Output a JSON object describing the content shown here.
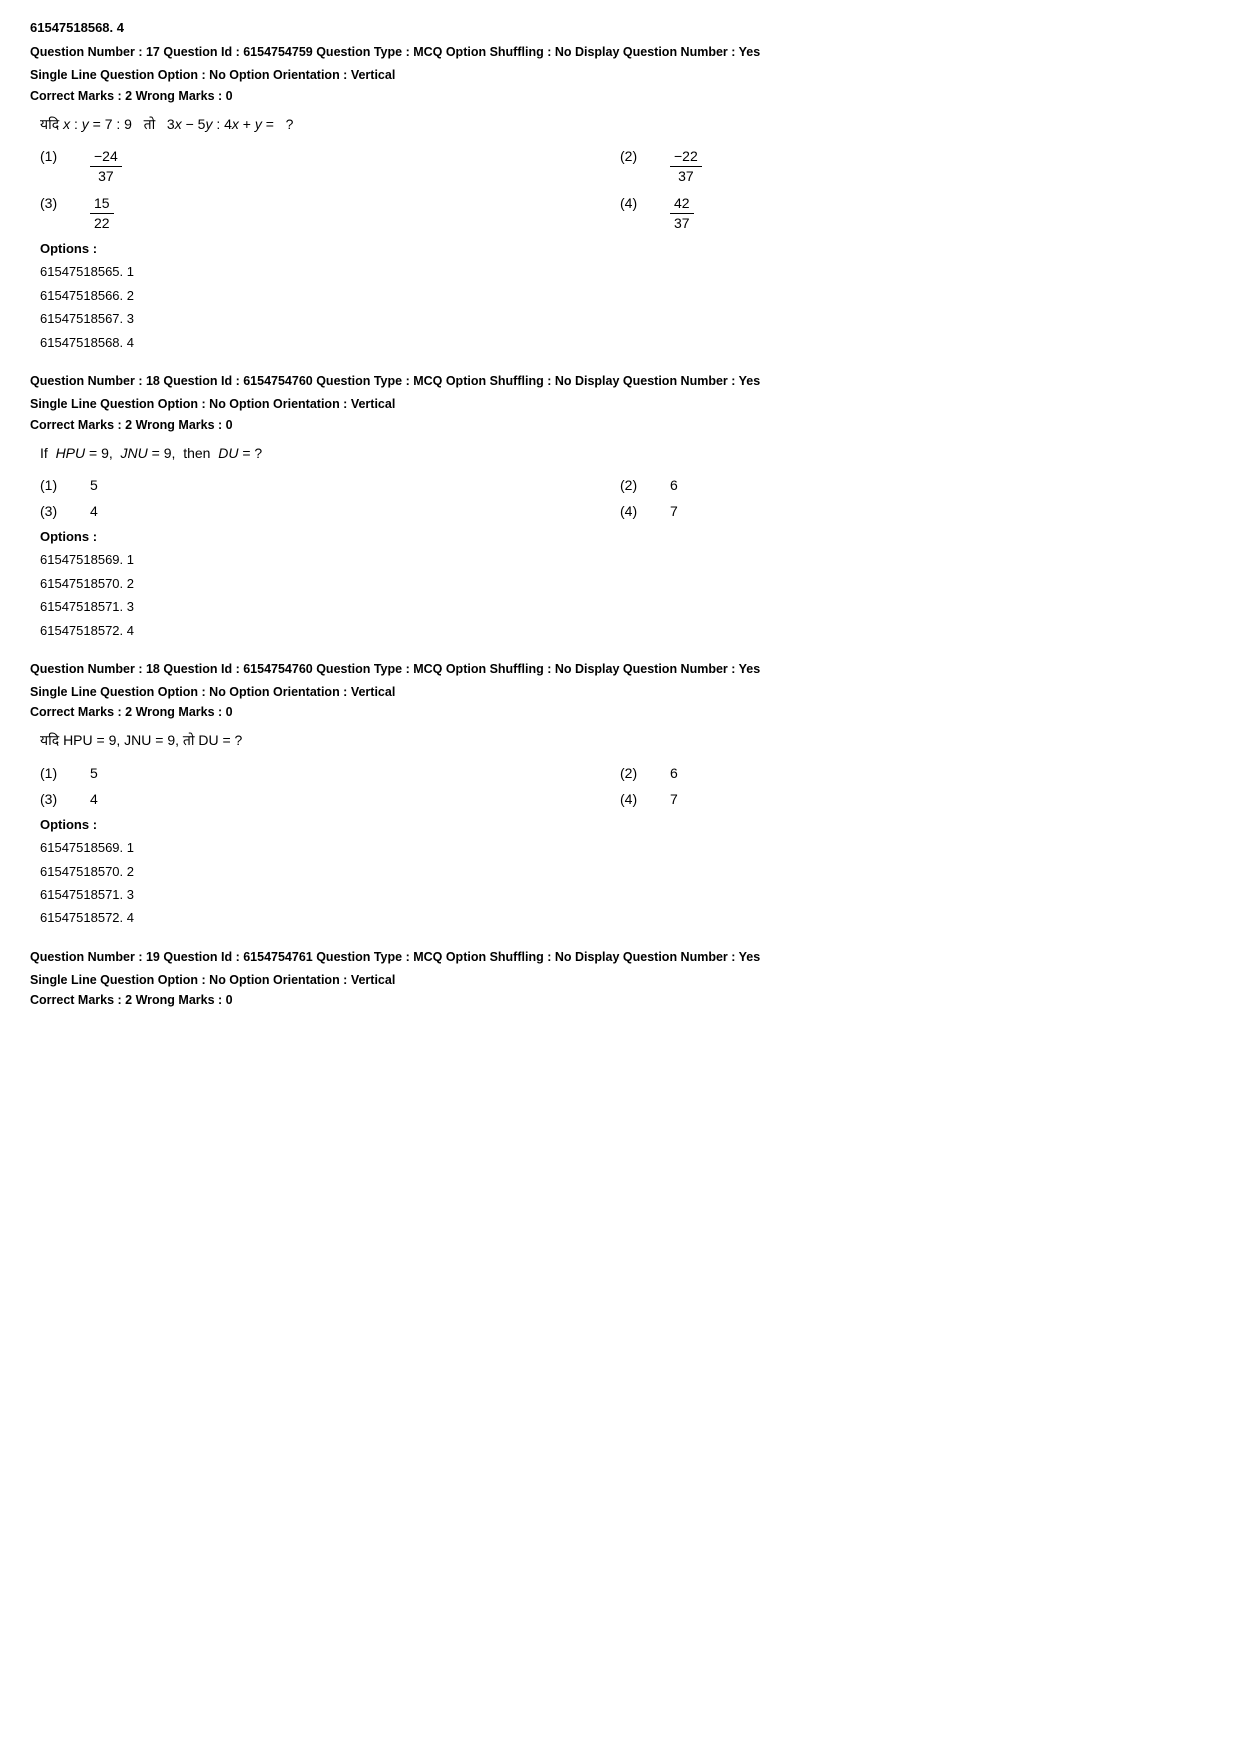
{
  "topId": "61547518568. 4",
  "questions": [
    {
      "id": "q17",
      "meta1": "Question Number : 17  Question Id : 6154754759  Question Type : MCQ  Option Shuffling : No  Display Question Number : Yes",
      "meta2": "Single Line Question Option : No  Option Orientation : Vertical",
      "marks": "Correct Marks : 2  Wrong Marks : 0",
      "questionType": "fraction",
      "questionText": "यदि x : y = 7 : 9  तो  3x − 5y : 4x + y =  ?",
      "options": [
        {
          "num": "(1)",
          "type": "fraction",
          "numerator": "−24",
          "denominator": "37"
        },
        {
          "num": "(2)",
          "type": "fraction",
          "numerator": "−22",
          "denominator": "37"
        },
        {
          "num": "(3)",
          "type": "fraction",
          "numerator": "15",
          "denominator": "22"
        },
        {
          "num": "(4)",
          "type": "fraction",
          "numerator": "42",
          "denominator": "37"
        }
      ],
      "optionsLabel": "Options :",
      "optionsList": [
        "61547518565. 1",
        "61547518566. 2",
        "61547518567. 3",
        "61547518568. 4"
      ]
    },
    {
      "id": "q18a",
      "meta1": "Question Number : 18  Question Id : 6154754760  Question Type : MCQ  Option Shuffling : No  Display Question Number : Yes",
      "meta2": "Single Line Question Option : No  Option Orientation : Vertical",
      "marks": "Correct Marks : 2  Wrong Marks : 0",
      "questionType": "simple",
      "questionText": "If  HPU = 9,  JNU = 9,  then  DU = ?",
      "options": [
        {
          "num": "(1)",
          "type": "simple",
          "value": "5"
        },
        {
          "num": "(2)",
          "type": "simple",
          "value": "6"
        },
        {
          "num": "(3)",
          "type": "simple",
          "value": "4"
        },
        {
          "num": "(4)",
          "type": "simple",
          "value": "7"
        }
      ],
      "optionsLabel": "Options :",
      "optionsList": [
        "61547518569. 1",
        "61547518570. 2",
        "61547518571. 3",
        "61547518572. 4"
      ]
    },
    {
      "id": "q18b",
      "meta1": "Question Number : 18  Question Id : 6154754760  Question Type : MCQ  Option Shuffling : No  Display Question Number : Yes",
      "meta2": "Single Line Question Option : No  Option Orientation : Vertical",
      "marks": "Correct Marks : 2  Wrong Marks : 0",
      "questionType": "simple",
      "questionText": "यदि HPU = 9, JNU = 9, तो DU = ?",
      "options": [
        {
          "num": "(1)",
          "type": "simple",
          "value": "5"
        },
        {
          "num": "(2)",
          "type": "simple",
          "value": "6"
        },
        {
          "num": "(3)",
          "type": "simple",
          "value": "4"
        },
        {
          "num": "(4)",
          "type": "simple",
          "value": "7"
        }
      ],
      "optionsLabel": "Options :",
      "optionsList": [
        "61547518569. 1",
        "61547518570. 2",
        "61547518571. 3",
        "61547518572. 4"
      ]
    },
    {
      "id": "q19",
      "meta1": "Question Number : 19  Question Id : 6154754761  Question Type : MCQ  Option Shuffling : No  Display Question Number : Yes",
      "meta2": "Single Line Question Option : No  Option Orientation : Vertical",
      "marks": "Correct Marks : 2  Wrong Marks : 0",
      "questionType": "none",
      "questionText": "",
      "options": [],
      "optionsLabel": "",
      "optionsList": []
    }
  ]
}
